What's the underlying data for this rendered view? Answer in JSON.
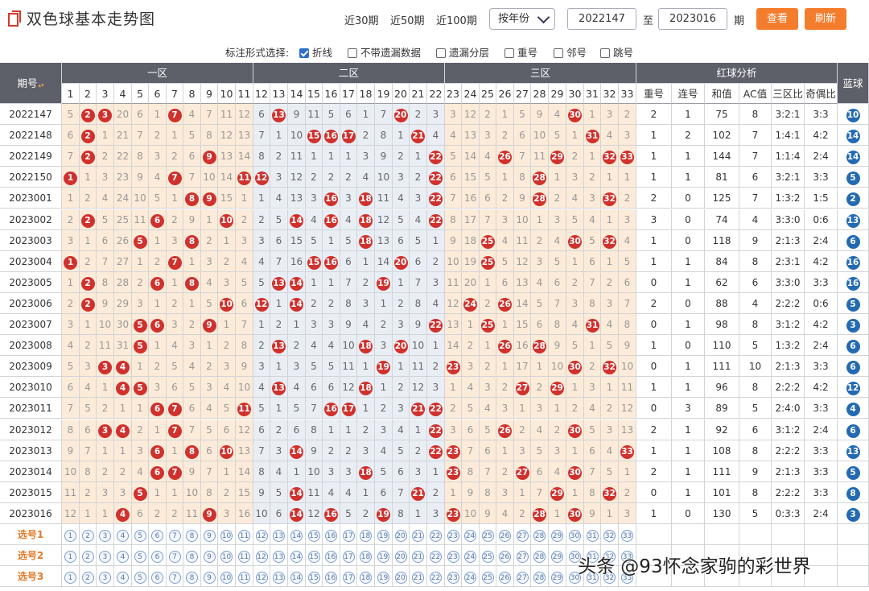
{
  "header": {
    "title": "双色球基本走势图",
    "quick_links": [
      "近30期",
      "近50期",
      "近100期"
    ],
    "mode_select": "按年份",
    "start_issue": "2022147",
    "to_label": "至",
    "end_issue": "2023016",
    "issue_suffix": "期",
    "view_button": "查看",
    "refresh_button": "刷新"
  },
  "options": {
    "label": "标注形式选择:",
    "items": [
      {
        "label": "折线",
        "checked": true
      },
      {
        "label": "不带遗漏数据",
        "checked": false
      },
      {
        "label": "遗漏分层",
        "checked": false
      },
      {
        "label": "重号",
        "checked": false
      },
      {
        "label": "邻号",
        "checked": false
      },
      {
        "label": "跳号",
        "checked": false
      }
    ]
  },
  "table": {
    "issue_header": "期号",
    "zone_headers": [
      "一区",
      "二区",
      "三区",
      "红球分析",
      "蓝球"
    ],
    "analysis_headers": [
      "重号",
      "连号",
      "和值",
      "AC值",
      "三区比",
      "奇偶比"
    ],
    "numbers": [
      "1",
      "2",
      "3",
      "4",
      "5",
      "6",
      "7",
      "8",
      "9",
      "10",
      "11",
      "12",
      "13",
      "14",
      "15",
      "16",
      "17",
      "18",
      "19",
      "20",
      "21",
      "22",
      "23",
      "24",
      "25",
      "26",
      "27",
      "28",
      "29",
      "30",
      "31",
      "32",
      "33"
    ],
    "rows": [
      {
        "issue": "2022147",
        "cells": [
          "5",
          "2",
          "3",
          "20",
          "6",
          "1",
          "7",
          "4",
          "7",
          "11",
          "12",
          "6",
          "13",
          "9",
          "11",
          "5",
          "6",
          "1",
          "7",
          "20",
          "2",
          "3",
          "3",
          "12",
          "2",
          "1",
          "5",
          "9",
          "4",
          "30",
          "1",
          "3",
          "2"
        ],
        "analysis": [
          "2",
          "1",
          "75",
          "8",
          "3:2:1",
          "3:3"
        ],
        "blue": "10"
      },
      {
        "issue": "2022148",
        "cells": [
          "6",
          "2",
          "1",
          "21",
          "7",
          "2",
          "1",
          "5",
          "8",
          "12",
          "13",
          "7",
          "1",
          "10",
          "15",
          "16",
          "17",
          "2",
          "8",
          "1",
          "21",
          "4",
          "4",
          "13",
          "3",
          "2",
          "6",
          "10",
          "5",
          "1",
          "31",
          "4",
          "3"
        ],
        "analysis": [
          "1",
          "2",
          "102",
          "7",
          "1:4:1",
          "4:2"
        ],
        "blue": "14"
      },
      {
        "issue": "2022149",
        "cells": [
          "7",
          "2",
          "2",
          "22",
          "8",
          "3",
          "2",
          "6",
          "9",
          "13",
          "14",
          "8",
          "2",
          "11",
          "1",
          "1",
          "1",
          "3",
          "9",
          "2",
          "1",
          "22",
          "5",
          "14",
          "4",
          "26",
          "7",
          "11",
          "29",
          "2",
          "1",
          "32",
          "33"
        ],
        "analysis": [
          "1",
          "1",
          "144",
          "7",
          "1:1:4",
          "2:4"
        ],
        "blue": "14"
      },
      {
        "issue": "2022150",
        "cells": [
          "1",
          "1",
          "3",
          "23",
          "9",
          "4",
          "7",
          "7",
          "10",
          "14",
          "11",
          "12",
          "3",
          "12",
          "2",
          "2",
          "2",
          "4",
          "10",
          "3",
          "2",
          "22",
          "6",
          "15",
          "5",
          "1",
          "8",
          "28",
          "1",
          "3",
          "2",
          "1",
          "1"
        ],
        "analysis": [
          "1",
          "1",
          "81",
          "6",
          "3:2:1",
          "3:3"
        ],
        "blue": "5"
      },
      {
        "issue": "2023001",
        "cells": [
          "1",
          "2",
          "4",
          "24",
          "10",
          "5",
          "1",
          "8",
          "9",
          "15",
          "1",
          "1",
          "4",
          "13",
          "3",
          "16",
          "3",
          "18",
          "11",
          "4",
          "3",
          "22",
          "7",
          "16",
          "6",
          "2",
          "9",
          "28",
          "2",
          "4",
          "3",
          "32",
          "2"
        ],
        "analysis": [
          "2",
          "0",
          "125",
          "7",
          "1:3:2",
          "1:5"
        ],
        "blue": "2"
      },
      {
        "issue": "2023002",
        "cells": [
          "2",
          "2",
          "5",
          "25",
          "11",
          "6",
          "2",
          "9",
          "1",
          "10",
          "2",
          "2",
          "5",
          "14",
          "4",
          "16",
          "4",
          "18",
          "12",
          "5",
          "4",
          "22",
          "8",
          "17",
          "7",
          "3",
          "10",
          "1",
          "3",
          "5",
          "4",
          "1",
          "3"
        ],
        "analysis": [
          "3",
          "0",
          "74",
          "4",
          "3:3:0",
          "0:6"
        ],
        "blue": "13"
      },
      {
        "issue": "2023003",
        "cells": [
          "3",
          "1",
          "6",
          "26",
          "5",
          "1",
          "3",
          "8",
          "2",
          "1",
          "3",
          "3",
          "6",
          "15",
          "5",
          "1",
          "5",
          "18",
          "13",
          "6",
          "5",
          "1",
          "9",
          "18",
          "25",
          "4",
          "11",
          "2",
          "4",
          "30",
          "5",
          "32",
          "4"
        ],
        "analysis": [
          "1",
          "0",
          "118",
          "9",
          "2:1:3",
          "2:4"
        ],
        "blue": "6"
      },
      {
        "issue": "2023004",
        "cells": [
          "1",
          "2",
          "7",
          "27",
          "1",
          "2",
          "7",
          "1",
          "3",
          "2",
          "4",
          "4",
          "7",
          "16",
          "15",
          "16",
          "6",
          "1",
          "14",
          "20",
          "6",
          "2",
          "10",
          "19",
          "25",
          "5",
          "12",
          "3",
          "5",
          "1",
          "6",
          "1",
          "5"
        ],
        "analysis": [
          "1",
          "1",
          "84",
          "8",
          "2:3:1",
          "4:2"
        ],
        "blue": "16"
      },
      {
        "issue": "2023005",
        "cells": [
          "1",
          "2",
          "8",
          "28",
          "2",
          "6",
          "1",
          "8",
          "4",
          "3",
          "5",
          "5",
          "13",
          "14",
          "1",
          "1",
          "7",
          "2",
          "19",
          "1",
          "7",
          "3",
          "11",
          "20",
          "1",
          "6",
          "13",
          "4",
          "6",
          "2",
          "7",
          "2",
          "6"
        ],
        "analysis": [
          "0",
          "1",
          "62",
          "6",
          "3:3:0",
          "3:3"
        ],
        "blue": "16"
      },
      {
        "issue": "2023006",
        "cells": [
          "2",
          "2",
          "9",
          "29",
          "3",
          "1",
          "2",
          "1",
          "5",
          "10",
          "6",
          "12",
          "1",
          "14",
          "2",
          "2",
          "8",
          "3",
          "1",
          "2",
          "8",
          "4",
          "12",
          "24",
          "2",
          "26",
          "14",
          "5",
          "7",
          "3",
          "8",
          "3",
          "7"
        ],
        "analysis": [
          "2",
          "0",
          "88",
          "4",
          "2:2:2",
          "0:6"
        ],
        "blue": "5"
      },
      {
        "issue": "2023007",
        "cells": [
          "3",
          "1",
          "10",
          "30",
          "5",
          "6",
          "3",
          "2",
          "9",
          "1",
          "7",
          "1",
          "2",
          "1",
          "3",
          "3",
          "9",
          "4",
          "2",
          "3",
          "9",
          "22",
          "13",
          "1",
          "25",
          "1",
          "15",
          "6",
          "8",
          "4",
          "31",
          "4",
          "8"
        ],
        "analysis": [
          "0",
          "1",
          "98",
          "8",
          "3:1:2",
          "4:2"
        ],
        "blue": "3"
      },
      {
        "issue": "2023008",
        "cells": [
          "4",
          "2",
          "11",
          "31",
          "5",
          "1",
          "4",
          "3",
          "1",
          "2",
          "8",
          "2",
          "13",
          "2",
          "4",
          "4",
          "10",
          "18",
          "3",
          "20",
          "10",
          "1",
          "14",
          "2",
          "1",
          "26",
          "16",
          "28",
          "9",
          "5",
          "1",
          "5",
          "9"
        ],
        "analysis": [
          "1",
          "0",
          "110",
          "5",
          "1:3:2",
          "2:4"
        ],
        "blue": "6"
      },
      {
        "issue": "2023009",
        "cells": [
          "5",
          "3",
          "3",
          "4",
          "1",
          "2",
          "5",
          "4",
          "2",
          "3",
          "9",
          "3",
          "1",
          "3",
          "5",
          "5",
          "11",
          "1",
          "19",
          "1",
          "11",
          "2",
          "23",
          "3",
          "2",
          "1",
          "17",
          "1",
          "10",
          "30",
          "2",
          "32",
          "10"
        ],
        "analysis": [
          "0",
          "1",
          "111",
          "10",
          "2:1:3",
          "3:3"
        ],
        "blue": "6"
      },
      {
        "issue": "2023010",
        "cells": [
          "6",
          "4",
          "1",
          "4",
          "5",
          "3",
          "6",
          "5",
          "3",
          "4",
          "10",
          "4",
          "13",
          "4",
          "6",
          "6",
          "12",
          "18",
          "1",
          "2",
          "12",
          "3",
          "1",
          "4",
          "3",
          "2",
          "27",
          "2",
          "29",
          "1",
          "3",
          "1",
          "11"
        ],
        "analysis": [
          "1",
          "1",
          "96",
          "8",
          "2:2:2",
          "4:2"
        ],
        "blue": "12"
      },
      {
        "issue": "2023011",
        "cells": [
          "7",
          "5",
          "2",
          "1",
          "1",
          "6",
          "7",
          "6",
          "4",
          "5",
          "11",
          "5",
          "1",
          "5",
          "7",
          "16",
          "17",
          "1",
          "2",
          "3",
          "21",
          "22",
          "2",
          "5",
          "4",
          "3",
          "1",
          "3",
          "1",
          "2",
          "4",
          "2",
          "12"
        ],
        "analysis": [
          "0",
          "3",
          "89",
          "5",
          "2:4:0",
          "3:3"
        ],
        "blue": "4"
      },
      {
        "issue": "2023012",
        "cells": [
          "8",
          "6",
          "3",
          "4",
          "2",
          "1",
          "7",
          "7",
          "5",
          "6",
          "12",
          "6",
          "2",
          "6",
          "8",
          "1",
          "1",
          "2",
          "3",
          "4",
          "1",
          "22",
          "3",
          "6",
          "5",
          "26",
          "2",
          "4",
          "2",
          "30",
          "5",
          "3",
          "13"
        ],
        "analysis": [
          "2",
          "1",
          "92",
          "6",
          "3:1:2",
          "2:4"
        ],
        "blue": "6"
      },
      {
        "issue": "2023013",
        "cells": [
          "9",
          "7",
          "1",
          "1",
          "3",
          "6",
          "1",
          "8",
          "6",
          "10",
          "13",
          "7",
          "3",
          "14",
          "9",
          "2",
          "2",
          "3",
          "4",
          "5",
          "2",
          "22",
          "23",
          "7",
          "6",
          "1",
          "3",
          "5",
          "3",
          "1",
          "6",
          "4",
          "33"
        ],
        "analysis": [
          "1",
          "1",
          "108",
          "8",
          "2:2:2",
          "3:3"
        ],
        "blue": "13"
      },
      {
        "issue": "2023014",
        "cells": [
          "10",
          "8",
          "2",
          "2",
          "4",
          "6",
          "7",
          "9",
          "7",
          "1",
          "14",
          "8",
          "4",
          "1",
          "10",
          "3",
          "3",
          "18",
          "5",
          "6",
          "3",
          "1",
          "23",
          "8",
          "7",
          "2",
          "27",
          "6",
          "4",
          "30",
          "7",
          "5",
          "1"
        ],
        "analysis": [
          "2",
          "1",
          "111",
          "9",
          "2:1:3",
          "3:3"
        ],
        "blue": "5"
      },
      {
        "issue": "2023015",
        "cells": [
          "11",
          "2",
          "3",
          "3",
          "5",
          "1",
          "1",
          "10",
          "8",
          "2",
          "15",
          "9",
          "5",
          "14",
          "11",
          "4",
          "4",
          "1",
          "6",
          "7",
          "21",
          "2",
          "1",
          "9",
          "8",
          "3",
          "1",
          "7",
          "29",
          "1",
          "8",
          "32",
          "2"
        ],
        "analysis": [
          "0",
          "1",
          "101",
          "8",
          "2:2:2",
          "3:3"
        ],
        "blue": "8"
      },
      {
        "issue": "2023016",
        "cells": [
          "12",
          "1",
          "1",
          "4",
          "6",
          "2",
          "2",
          "11",
          "9",
          "3",
          "16",
          "10",
          "6",
          "14",
          "12",
          "16",
          "5",
          "2",
          "19",
          "8",
          "1",
          "3",
          "23",
          "10",
          "9",
          "4",
          "2",
          "28",
          "1",
          "30",
          "9",
          "1",
          "3"
        ],
        "analysis": [
          "1",
          "0",
          "130",
          "5",
          "0:3:3",
          "2:4"
        ],
        "blue": "3"
      }
    ],
    "pick_rows": [
      "选号1",
      "选号2",
      "选号3"
    ]
  },
  "watermark": "头条 @93怀念家驹的彩世界"
}
